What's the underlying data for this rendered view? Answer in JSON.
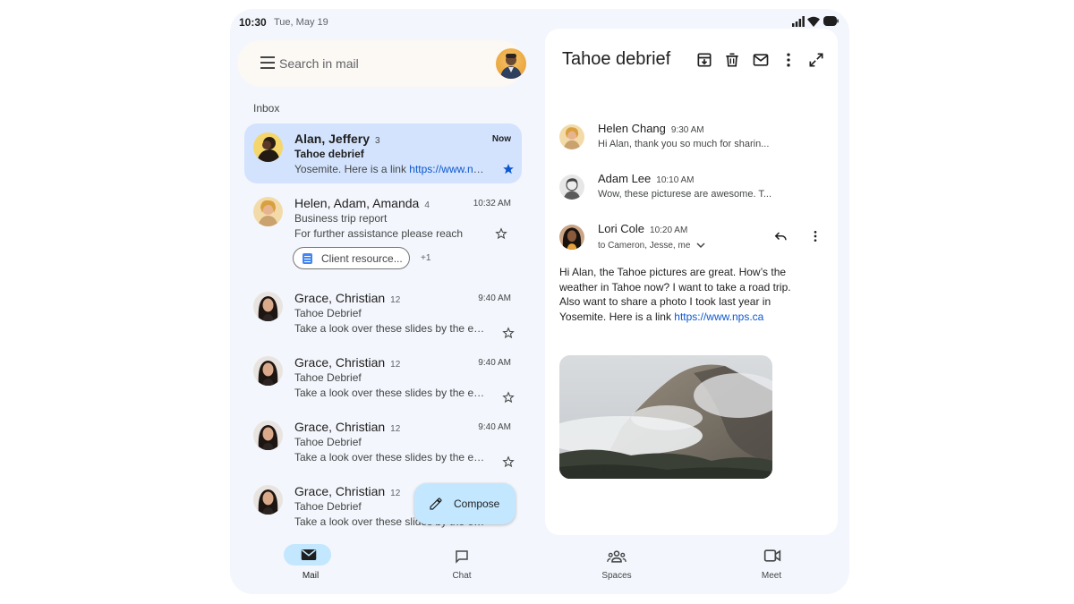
{
  "status_bar": {
    "time": "10:30",
    "date": "Tue, May 19"
  },
  "search": {
    "placeholder": "Search in mail"
  },
  "inbox_label": "Inbox",
  "mail_list": [
    {
      "sender": "Alan, Jeffery",
      "count": "3",
      "time": "Now",
      "subject": "Tahoe debrief",
      "snippet": "Yosemite. Here is a link ",
      "link": "https://www.nps.ca",
      "starred": true,
      "selected": true
    },
    {
      "sender": "Helen, Adam, Amanda",
      "count": "4",
      "time": "10:32 AM",
      "subject": "Business trip report",
      "snippet": "For further assistance please reach",
      "starred": false,
      "attachment": "Client resource...",
      "attachment_more": "+1"
    },
    {
      "sender": "Grace, Christian",
      "count": "12",
      "time": "9:40 AM",
      "subject": "Tahoe Debrief",
      "snippet": "Take a look over these slides by the end...",
      "starred": false
    },
    {
      "sender": "Grace, Christian",
      "count": "12",
      "time": "9:40 AM",
      "subject": "Tahoe Debrief",
      "snippet": "Take a look over these slides by the end...",
      "starred": false
    },
    {
      "sender": "Grace, Christian",
      "count": "12",
      "time": "9:40 AM",
      "subject": "Tahoe Debrief",
      "snippet": "Take a look over these slides by the end...",
      "starred": false
    },
    {
      "sender": "Grace, Christian",
      "count": "12",
      "time": "",
      "subject": "Tahoe Debrief",
      "snippet": "Take a look over these slides by the end...",
      "starred": false
    }
  ],
  "compose": {
    "label": "Compose"
  },
  "thread": {
    "title": "Tahoe debrief",
    "toolbar": [
      "archive-icon",
      "delete-icon",
      "mark-unread-icon",
      "more-vert-icon",
      "expand-icon"
    ],
    "messages": [
      {
        "sender": "Helen Chang",
        "time": "9:30 AM",
        "snippet": "Hi Alan, thank you so much for sharin..."
      },
      {
        "sender": "Adam Lee",
        "time": "10:10 AM",
        "snippet": "Wow, these picturese are awesome. T..."
      },
      {
        "sender": "Lori Cole",
        "time": "10:20 AM",
        "recipients": "to Cameron, Jesse, me"
      }
    ],
    "body": "Hi Alan, the Tahoe pictures are great. How’s the weather in Tahoe now? I want to take a road trip. Also want to share a photo I took last year in Yosemite. Here is a link ",
    "body_link": "https://www.nps.ca"
  },
  "nav": [
    {
      "label": "Mail",
      "icon": "mail-icon",
      "active": true
    },
    {
      "label": "Chat",
      "icon": "chat-icon",
      "active": false
    },
    {
      "label": "Spaces",
      "icon": "spaces-icon",
      "active": false
    },
    {
      "label": "Meet",
      "icon": "meet-icon",
      "active": false
    }
  ],
  "colors": {
    "accent": "#0b57d0",
    "selected_bg": "#d3e3fd",
    "fab_bg": "#c2e7ff",
    "surface": "#f3f6fc"
  }
}
